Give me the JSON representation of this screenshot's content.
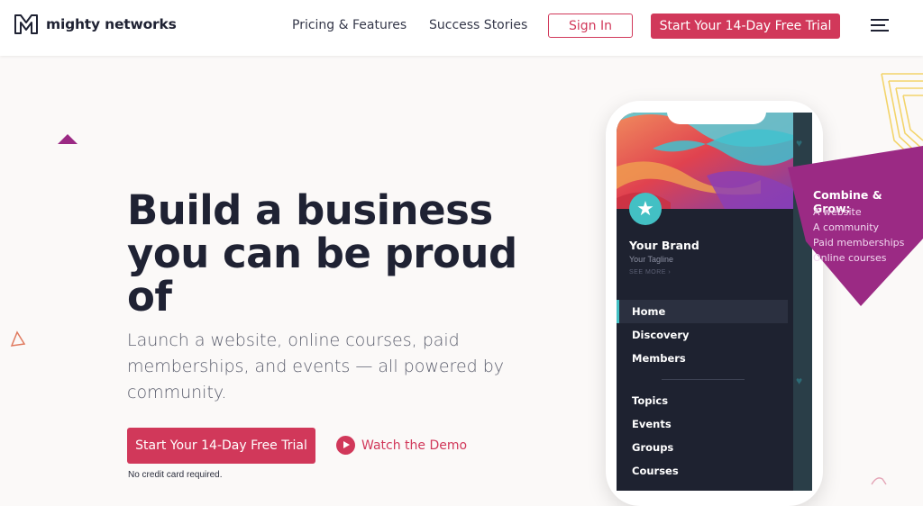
{
  "header": {
    "logo_text": "mighty networks",
    "nav": [
      "Pricing & Features",
      "Success Stories"
    ],
    "sign_in": "Sign In",
    "trial": "Start Your 14-Day Free Trial"
  },
  "hero": {
    "headline": "Build a business you can be proud of",
    "subtext": "Launch a website, online courses, paid memberships, and events — all powered by community.",
    "cta": "Start Your 14-Day Free Trial",
    "no_credit_card": "No credit card required.",
    "demo": "Watch the Demo"
  },
  "phone": {
    "brand_name": "Your Brand",
    "tagline": "Your Tagline",
    "see_more": "SEE MORE",
    "menu_primary": [
      "Home",
      "Discovery",
      "Members"
    ],
    "menu_secondary": [
      "Topics",
      "Events",
      "Groups",
      "Courses"
    ]
  },
  "callout": {
    "title": "Combine & Grow:",
    "items": [
      "A website",
      "A community",
      "Paid memberships",
      "Online courses"
    ]
  },
  "colors": {
    "accent": "#d1385a",
    "teal": "#43c0c4",
    "purple": "#9b2a84",
    "dark": "#1f2233"
  }
}
